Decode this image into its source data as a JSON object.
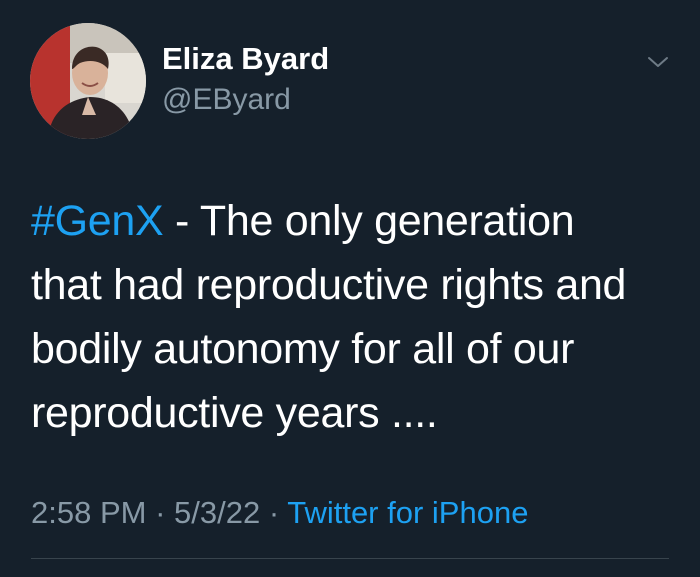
{
  "author": {
    "display_name": "Eliza Byard",
    "handle": "@EByard"
  },
  "tweet": {
    "hashtag": "#GenX",
    "line1_rest": " - The only generation",
    "line2": "that had reproductive rights and",
    "line3": "bodily autonomy for all of our",
    "line4": "reproductive years ...."
  },
  "meta": {
    "time": "2:58 PM",
    "separator": " · ",
    "date": "5/3/22",
    "source": "Twitter for iPhone"
  },
  "icons": {
    "menu": "chevron-down-icon",
    "avatar": "profile-photo"
  },
  "colors": {
    "background": "#15202b",
    "text": "#ffffff",
    "secondary_text": "#8899a6",
    "accent": "#1da1f2",
    "divider": "#38444d"
  }
}
